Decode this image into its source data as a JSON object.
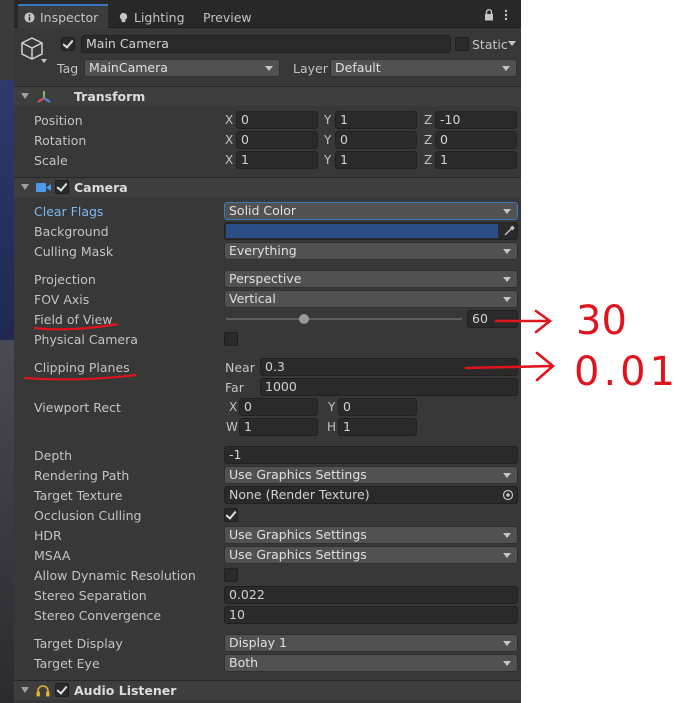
{
  "tabs": [
    {
      "label": "Inspector"
    },
    {
      "label": "Lighting"
    },
    {
      "label": "Preview"
    }
  ],
  "object": {
    "name": "Main Camera",
    "static_label": "Static",
    "tag_label": "Tag",
    "tag_value": "MainCamera",
    "layer_label": "Layer",
    "layer_value": "Default"
  },
  "transform": {
    "title": "Transform",
    "rows": [
      {
        "label": "Position",
        "x": "0",
        "y": "1",
        "z": "-10"
      },
      {
        "label": "Rotation",
        "x": "0",
        "y": "0",
        "z": "0"
      },
      {
        "label": "Scale",
        "x": "1",
        "y": "1",
        "z": "1"
      }
    ],
    "axes": {
      "x": "X",
      "y": "Y",
      "z": "Z"
    }
  },
  "camera": {
    "title": "Camera",
    "clear_flags": {
      "label": "Clear Flags",
      "value": "Solid Color"
    },
    "background": {
      "label": "Background",
      "color": "#2b4d86"
    },
    "culling_mask": {
      "label": "Culling Mask",
      "value": "Everything"
    },
    "projection": {
      "label": "Projection",
      "value": "Perspective"
    },
    "fov_axis": {
      "label": "FOV Axis",
      "value": "Vertical"
    },
    "field_of_view": {
      "label": "Field of View",
      "value": "60",
      "slider_fraction": 0.33
    },
    "physical_camera": {
      "label": "Physical Camera"
    },
    "clipping_planes": {
      "label": "Clipping Planes",
      "near_label": "Near",
      "near": "0.3",
      "far_label": "Far",
      "far": "1000"
    },
    "viewport_rect": {
      "label": "Viewport Rect",
      "x": "0",
      "y": "0",
      "w": "1",
      "h": "1",
      "x_label": "X",
      "y_label": "Y",
      "w_label": "W",
      "h_label": "H"
    },
    "depth": {
      "label": "Depth",
      "value": "-1"
    },
    "rendering_path": {
      "label": "Rendering Path",
      "value": "Use Graphics Settings"
    },
    "target_texture": {
      "label": "Target Texture",
      "value": "None (Render Texture)"
    },
    "occlusion_culling": {
      "label": "Occlusion Culling"
    },
    "hdr": {
      "label": "HDR",
      "value": "Use Graphics Settings"
    },
    "msaa": {
      "label": "MSAA",
      "value": "Use Graphics Settings"
    },
    "allow_dynamic_resolution": {
      "label": "Allow Dynamic Resolution"
    },
    "stereo_separation": {
      "label": "Stereo Separation",
      "value": "0.022"
    },
    "stereo_convergence": {
      "label": "Stereo Convergence",
      "value": "10"
    },
    "target_display": {
      "label": "Target Display",
      "value": "Display 1"
    },
    "target_eye": {
      "label": "Target Eye",
      "value": "Both"
    }
  },
  "audio_listener": {
    "title": "Audio Listener"
  },
  "annotations": {
    "fov_note": "30",
    "clip_note": "0.01"
  },
  "colors": {
    "accent": "#3a79bb",
    "annotation": "#e0141e"
  }
}
